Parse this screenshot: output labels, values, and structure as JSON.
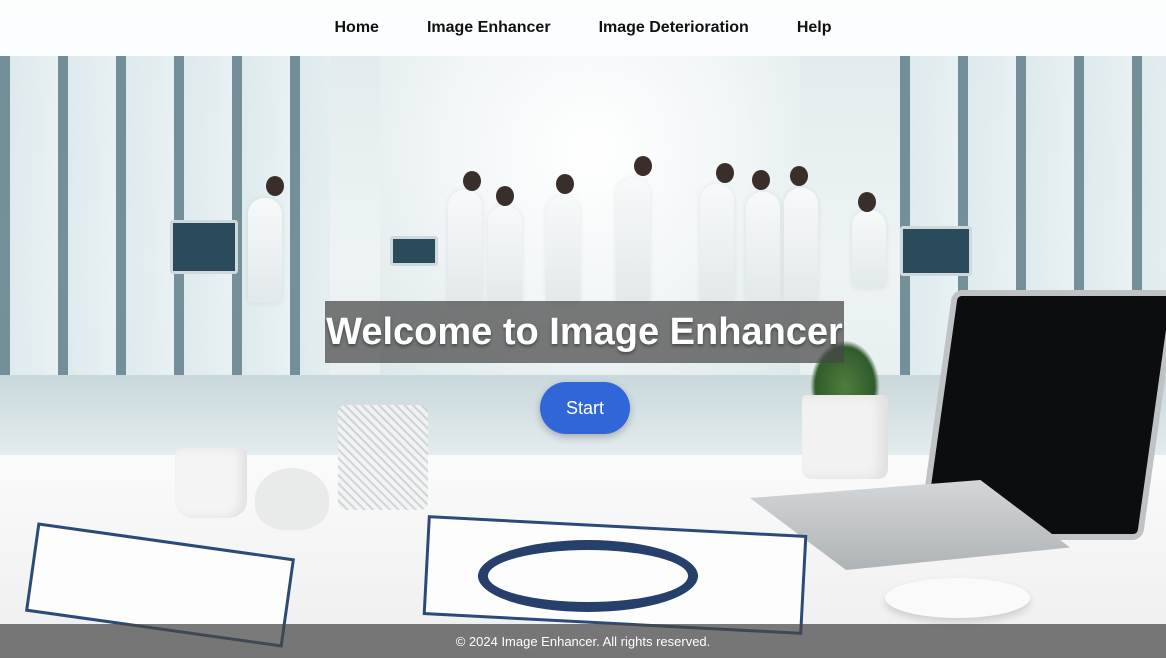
{
  "nav": {
    "items": [
      {
        "label": "Home"
      },
      {
        "label": "Image Enhancer"
      },
      {
        "label": "Image Deterioration"
      },
      {
        "label": "Help"
      }
    ]
  },
  "hero": {
    "title": "Welcome to Image Enhancer",
    "start_label": "Start"
  },
  "footer": {
    "text": "© 2024 Image Enhancer. All rights reserved."
  },
  "colors": {
    "accent": "#3166d9",
    "overlay": "#464646"
  }
}
